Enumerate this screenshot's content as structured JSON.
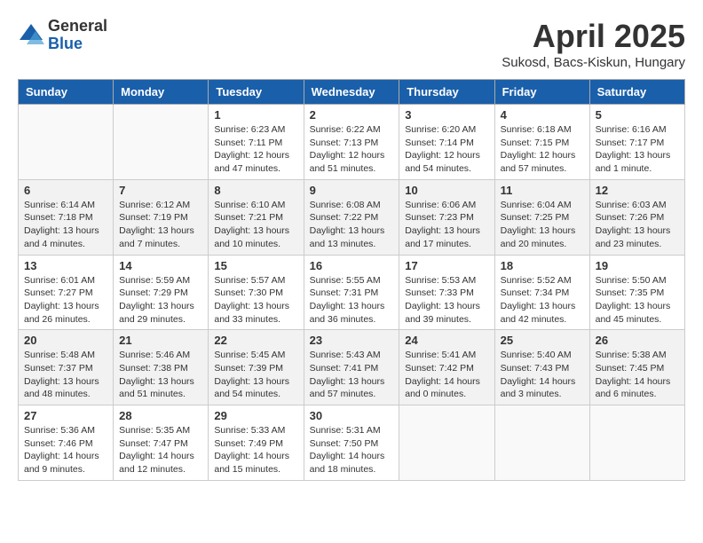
{
  "header": {
    "logo_general": "General",
    "logo_blue": "Blue",
    "month_title": "April 2025",
    "subtitle": "Sukosd, Bacs-Kiskun, Hungary"
  },
  "weekdays": [
    "Sunday",
    "Monday",
    "Tuesday",
    "Wednesday",
    "Thursday",
    "Friday",
    "Saturday"
  ],
  "weeks": [
    [
      {
        "day": "",
        "info": ""
      },
      {
        "day": "",
        "info": ""
      },
      {
        "day": "1",
        "info": "Sunrise: 6:23 AM\nSunset: 7:11 PM\nDaylight: 12 hours and 47 minutes."
      },
      {
        "day": "2",
        "info": "Sunrise: 6:22 AM\nSunset: 7:13 PM\nDaylight: 12 hours and 51 minutes."
      },
      {
        "day": "3",
        "info": "Sunrise: 6:20 AM\nSunset: 7:14 PM\nDaylight: 12 hours and 54 minutes."
      },
      {
        "day": "4",
        "info": "Sunrise: 6:18 AM\nSunset: 7:15 PM\nDaylight: 12 hours and 57 minutes."
      },
      {
        "day": "5",
        "info": "Sunrise: 6:16 AM\nSunset: 7:17 PM\nDaylight: 13 hours and 1 minute."
      }
    ],
    [
      {
        "day": "6",
        "info": "Sunrise: 6:14 AM\nSunset: 7:18 PM\nDaylight: 13 hours and 4 minutes."
      },
      {
        "day": "7",
        "info": "Sunrise: 6:12 AM\nSunset: 7:19 PM\nDaylight: 13 hours and 7 minutes."
      },
      {
        "day": "8",
        "info": "Sunrise: 6:10 AM\nSunset: 7:21 PM\nDaylight: 13 hours and 10 minutes."
      },
      {
        "day": "9",
        "info": "Sunrise: 6:08 AM\nSunset: 7:22 PM\nDaylight: 13 hours and 13 minutes."
      },
      {
        "day": "10",
        "info": "Sunrise: 6:06 AM\nSunset: 7:23 PM\nDaylight: 13 hours and 17 minutes."
      },
      {
        "day": "11",
        "info": "Sunrise: 6:04 AM\nSunset: 7:25 PM\nDaylight: 13 hours and 20 minutes."
      },
      {
        "day": "12",
        "info": "Sunrise: 6:03 AM\nSunset: 7:26 PM\nDaylight: 13 hours and 23 minutes."
      }
    ],
    [
      {
        "day": "13",
        "info": "Sunrise: 6:01 AM\nSunset: 7:27 PM\nDaylight: 13 hours and 26 minutes."
      },
      {
        "day": "14",
        "info": "Sunrise: 5:59 AM\nSunset: 7:29 PM\nDaylight: 13 hours and 29 minutes."
      },
      {
        "day": "15",
        "info": "Sunrise: 5:57 AM\nSunset: 7:30 PM\nDaylight: 13 hours and 33 minutes."
      },
      {
        "day": "16",
        "info": "Sunrise: 5:55 AM\nSunset: 7:31 PM\nDaylight: 13 hours and 36 minutes."
      },
      {
        "day": "17",
        "info": "Sunrise: 5:53 AM\nSunset: 7:33 PM\nDaylight: 13 hours and 39 minutes."
      },
      {
        "day": "18",
        "info": "Sunrise: 5:52 AM\nSunset: 7:34 PM\nDaylight: 13 hours and 42 minutes."
      },
      {
        "day": "19",
        "info": "Sunrise: 5:50 AM\nSunset: 7:35 PM\nDaylight: 13 hours and 45 minutes."
      }
    ],
    [
      {
        "day": "20",
        "info": "Sunrise: 5:48 AM\nSunset: 7:37 PM\nDaylight: 13 hours and 48 minutes."
      },
      {
        "day": "21",
        "info": "Sunrise: 5:46 AM\nSunset: 7:38 PM\nDaylight: 13 hours and 51 minutes."
      },
      {
        "day": "22",
        "info": "Sunrise: 5:45 AM\nSunset: 7:39 PM\nDaylight: 13 hours and 54 minutes."
      },
      {
        "day": "23",
        "info": "Sunrise: 5:43 AM\nSunset: 7:41 PM\nDaylight: 13 hours and 57 minutes."
      },
      {
        "day": "24",
        "info": "Sunrise: 5:41 AM\nSunset: 7:42 PM\nDaylight: 14 hours and 0 minutes."
      },
      {
        "day": "25",
        "info": "Sunrise: 5:40 AM\nSunset: 7:43 PM\nDaylight: 14 hours and 3 minutes."
      },
      {
        "day": "26",
        "info": "Sunrise: 5:38 AM\nSunset: 7:45 PM\nDaylight: 14 hours and 6 minutes."
      }
    ],
    [
      {
        "day": "27",
        "info": "Sunrise: 5:36 AM\nSunset: 7:46 PM\nDaylight: 14 hours and 9 minutes."
      },
      {
        "day": "28",
        "info": "Sunrise: 5:35 AM\nSunset: 7:47 PM\nDaylight: 14 hours and 12 minutes."
      },
      {
        "day": "29",
        "info": "Sunrise: 5:33 AM\nSunset: 7:49 PM\nDaylight: 14 hours and 15 minutes."
      },
      {
        "day": "30",
        "info": "Sunrise: 5:31 AM\nSunset: 7:50 PM\nDaylight: 14 hours and 18 minutes."
      },
      {
        "day": "",
        "info": ""
      },
      {
        "day": "",
        "info": ""
      },
      {
        "day": "",
        "info": ""
      }
    ]
  ]
}
